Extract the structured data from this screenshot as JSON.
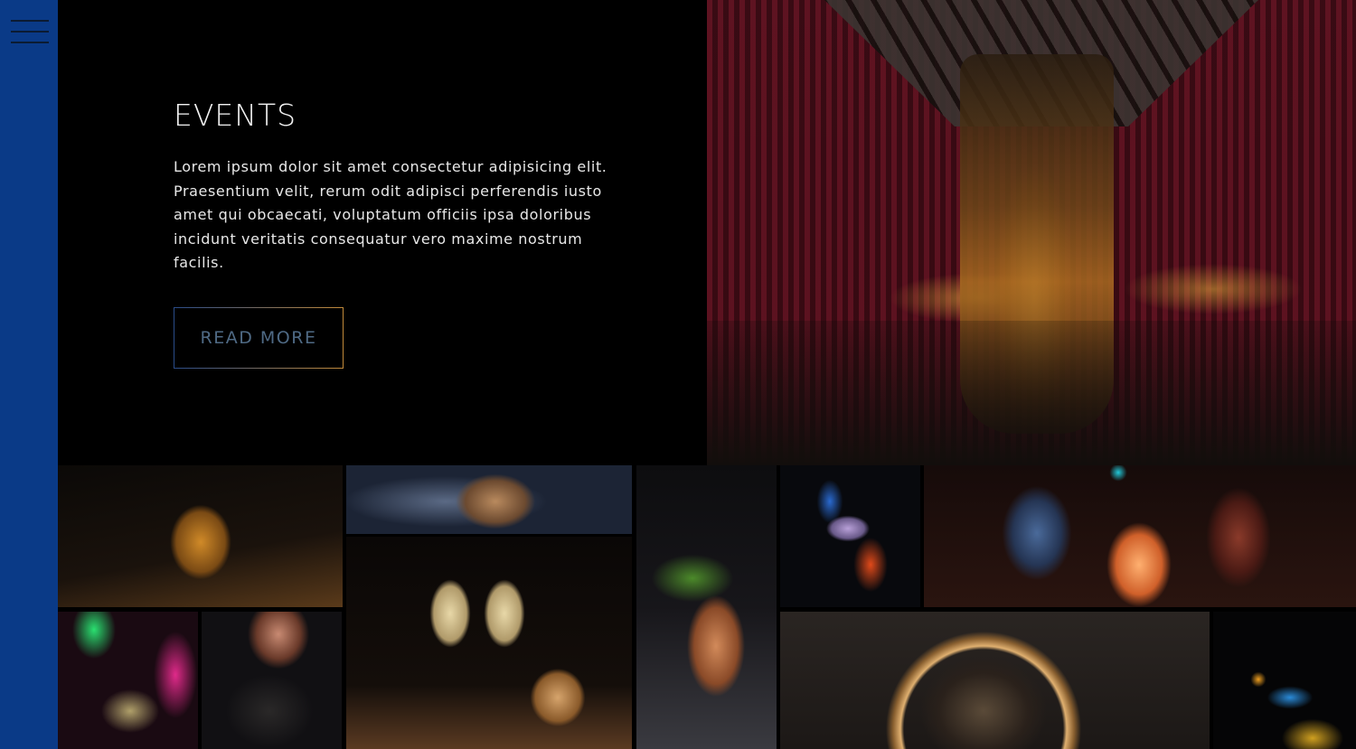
{
  "menu": {
    "icon": "hamburger-menu-icon"
  },
  "events": {
    "title": "EVENTS",
    "body": "Lorem ipsum dolor sit amet consectetur adipisicing elit. Praesentium velit, rerum odit adipisci perferendis iusto amet qui obcaecati, voluptatum officiis ipsa doloribus incidunt veritatis consequatur vero maxime nostrum facilis.",
    "button_label": "READ MORE"
  },
  "colors": {
    "sidebar": "#0a3a87",
    "background": "#000000",
    "button_text": "#4f6a85",
    "button_border_start": "#2a4c8a",
    "button_border_end": "#c28a3a"
  }
}
